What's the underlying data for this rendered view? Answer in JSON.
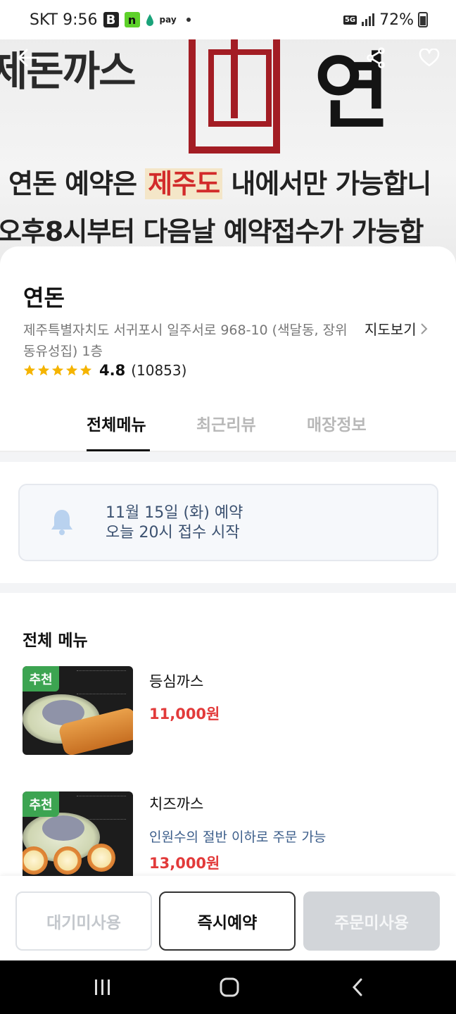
{
  "status_bar": {
    "carrier_time": "SKT 9:56",
    "icon_b": "B",
    "icon_n": "n",
    "pay_label": "pay",
    "network": "5G",
    "battery": "72%"
  },
  "hero": {
    "brand_left": "제돈까스",
    "brand_right": "연",
    "line1_pre": "연돈 예약은 ",
    "line1_highlight": "제주도",
    "line1_post": " 내에서만 가능합니",
    "line2": "오후8시부터 다음날 예약접수가 가능합",
    "back_icon": "back-arrow-icon",
    "share_icon": "share-icon",
    "favorite_icon": "heart-icon"
  },
  "store": {
    "name": "연돈",
    "address": "제주특별자치도 서귀포시 일주서로 968-10 (색달동, 장위동유성집) 1층",
    "map_link": "지도보기",
    "rating": "4.8",
    "review_count": "(10853)",
    "stars": 5
  },
  "tabs": [
    {
      "label": "전체메뉴",
      "active": true
    },
    {
      "label": "최근리뷰",
      "active": false
    },
    {
      "label": "매장정보",
      "active": false
    }
  ],
  "notice": {
    "line1": "11월 15일 (화) 예약",
    "line2": "오늘 20시 접수 시작"
  },
  "menu": {
    "title": "전체 메뉴",
    "items": [
      {
        "badge": "추천",
        "name": "등심까스",
        "note": "",
        "price": "11,000원"
      },
      {
        "badge": "추천",
        "name": "치즈까스",
        "note": "인원수의 절반 이하로 주문 가능",
        "price": "13,000원"
      }
    ]
  },
  "actions": {
    "wait": "대기미사용",
    "reserve": "즉시예약",
    "order": "주문미사용"
  },
  "colors": {
    "accent_red": "#e23a3a",
    "badge_green": "#3ca451",
    "notice_text": "#3b5170",
    "seal_red": "#a31d24"
  }
}
